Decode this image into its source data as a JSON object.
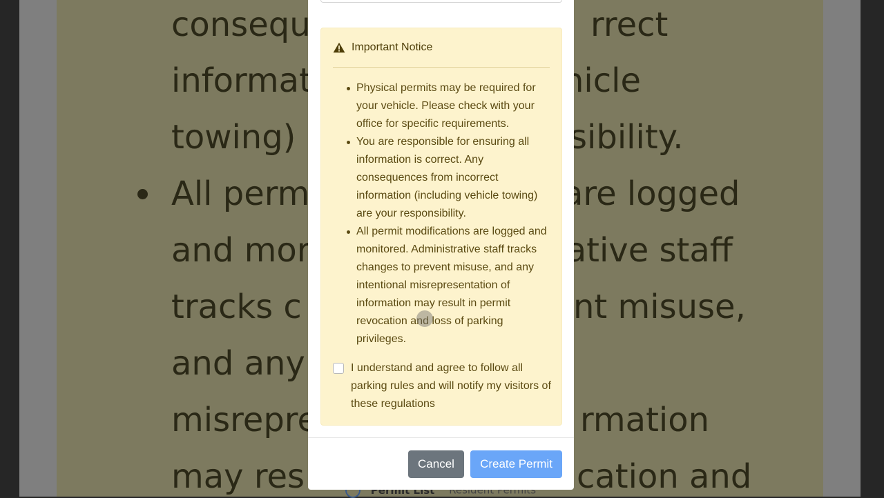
{
  "background": {
    "lines": [
      "consequ",
      "rrect",
      "informat",
      "hicle",
      "towing)",
      "sibility.",
      "All perm",
      "are logged",
      "and mor",
      "rative staff",
      "tracks c",
      "nt misuse,",
      "and any",
      "misrepre",
      "rmation",
      "may res",
      "cation and"
    ],
    "tabs": {
      "active_label": "Permit List",
      "other_label": "Resident Permits"
    }
  },
  "notice": {
    "title": "Important Notice",
    "icon": "warning-triangle-icon",
    "items": [
      "Physical permits may be required for your vehicle. Please check with your office for specific requirements.",
      "You are responsible for ensuring all information is correct. Any consequences from incorrect information (including vehicle towing) are your responsibility.",
      "All permit modifications are logged and monitored. Administrative staff tracks changes to prevent misuse, and any intentional misrepresentation of information may result in permit revocation and loss of parking privileges."
    ],
    "agreement_label": "I understand and agree to follow all parking rules and will notify my visitors of these regulations",
    "agreement_checked": false
  },
  "footer": {
    "cancel_label": "Cancel",
    "create_label": "Create Permit"
  },
  "colors": {
    "notice_bg": "#fdf3cd",
    "notice_text": "#5b4a12",
    "cancel_bg": "#6c757d",
    "create_bg": "#6aa6f8"
  }
}
